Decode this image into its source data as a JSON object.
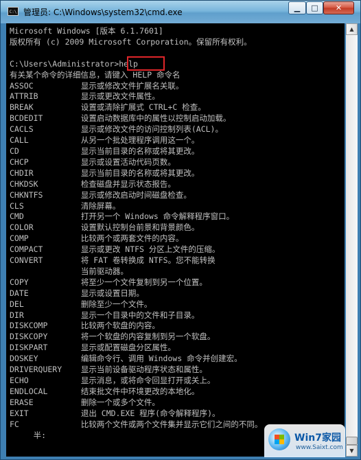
{
  "window": {
    "icon_text": "C:\\",
    "title": "管理员: C:\\Windows\\system32\\cmd.exe",
    "minimize_label": "▁",
    "maximize_label": "□",
    "close_label": "✕"
  },
  "console": {
    "lines": [
      "Microsoft Windows [版本 6.1.7601]",
      "版权所有 (c) 2009 Microsoft Corporation。保留所有权利。",
      "",
      "C:\\Users\\Administrator>help",
      "有关某个命令的详细信息，请键入 HELP 命令名",
      "ASSOC          显示或修改文件扩展名关联。",
      "ATTRIB         显示或更改文件属性。",
      "BREAK          设置或清除扩展式 CTRL+C 检查。",
      "BCDEDIT        设置启动数据库中的属性以控制启动加载。",
      "CACLS          显示或修改文件的访问控制列表(ACL)。",
      "CALL           从另一个批处理程序调用这一个。",
      "CD             显示当前目录的名称或将其更改。",
      "CHCP           显示或设置活动代码页数。",
      "CHDIR          显示当前目录的名称或将其更改。",
      "CHKDSK         检查磁盘并显示状态报告。",
      "CHKNTFS        显示或修改启动时间磁盘检查。",
      "CLS            清除屏幕。",
      "CMD            打开另一个 Windows 命令解释程序窗口。",
      "COLOR          设置默认控制台前景和背景颜色。",
      "COMP           比较两个或两套文件的内容。",
      "COMPACT        显示或更改 NTFS 分区上文件的压缩。",
      "CONVERT        将 FAT 卷转换成 NTFS。您不能转换",
      "               当前驱动器。",
      "COPY           将至少一个文件复制到另一个位置。",
      "DATE           显示或设置日期。",
      "DEL            删除至少一个文件。",
      "DIR            显示一个目录中的文件和子目录。",
      "DISKCOMP       比较两个软盘的内容。",
      "DISKCOPY       将一个软盘的内容复制到另一个软盘。",
      "DISKPART       显示或配置磁盘分区属性。",
      "DOSKEY         编辑命令行、调用 Windows 命令并创建宏。",
      "DRIVERQUERY    显示当前设备驱动程序状态和属性。",
      "ECHO           显示消息，或将命令回显打开或关上。",
      "ENDLOCAL       结束批文件中环境更改的本地化。",
      "ERASE          删除一个或多个文件。",
      "EXIT           退出 CMD.EXE 程序(命令解释程序)。",
      "FC             比较两个文件或两个文件集并显示它们之间的不同。",
      "     半:"
    ]
  },
  "scrollbar": {
    "up_glyph": "▲",
    "down_glyph": "▼"
  },
  "watermark": {
    "title": "Win7家园",
    "url": "www.Saixt.com"
  },
  "colors": {
    "console_bg": "#000000",
    "console_text": "#c0c0c0",
    "highlight": "#e0262a"
  }
}
